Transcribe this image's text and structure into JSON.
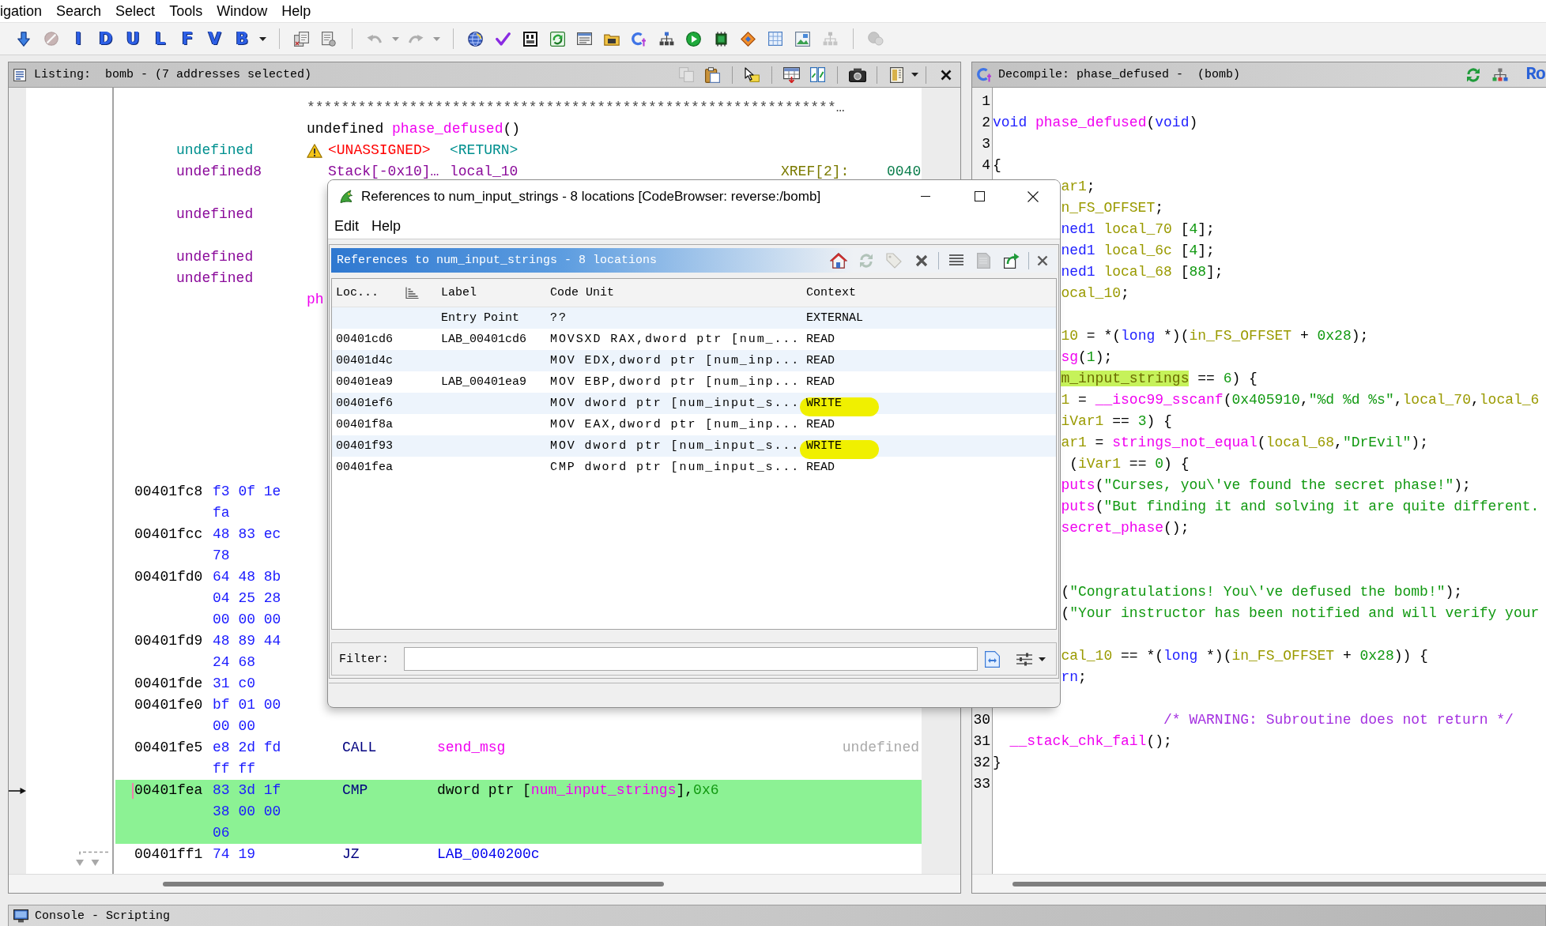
{
  "menu_bar": [
    "igation",
    "Search",
    "Select",
    "Tools",
    "Window",
    "Help"
  ],
  "toolbar": [
    [
      {
        "kind": "down-arrow",
        "disabled": false
      },
      {
        "kind": "stop",
        "disabled": true
      },
      {
        "kind": "letter",
        "label": "I",
        "disabled": false
      },
      {
        "kind": "letter",
        "label": "D",
        "disabled": false
      },
      {
        "kind": "letter",
        "label": "U",
        "disabled": false
      },
      {
        "kind": "letter",
        "label": "L",
        "disabled": false
      },
      {
        "kind": "letter",
        "label": "F",
        "disabled": false
      },
      {
        "kind": "letter",
        "label": "V",
        "disabled": false
      },
      {
        "kind": "letter",
        "label": "B",
        "disabled": false
      },
      {
        "kind": "caret",
        "disabled": false
      }
    ],
    [
      {
        "kind": "pages",
        "disabled": false
      },
      {
        "kind": "page",
        "disabled": false
      }
    ],
    [
      {
        "kind": "undo",
        "disabled": true
      },
      {
        "kind": "caret",
        "disabled": true
      },
      {
        "kind": "redo",
        "disabled": true
      },
      {
        "kind": "caret",
        "disabled": true
      }
    ],
    [
      {
        "kind": "globe",
        "disabled": false
      },
      {
        "kind": "check",
        "disabled": false
      },
      {
        "kind": "bytes",
        "disabled": false
      },
      {
        "kind": "script",
        "disabled": false
      },
      {
        "kind": "list",
        "disabled": false
      },
      {
        "kind": "folder",
        "disabled": false
      },
      {
        "kind": "code",
        "disabled": false
      },
      {
        "kind": "graph",
        "disabled": false
      },
      {
        "kind": "play",
        "disabled": false
      },
      {
        "kind": "chip",
        "disabled": false
      },
      {
        "kind": "diamond",
        "disabled": false
      },
      {
        "kind": "grid",
        "disabled": false
      },
      {
        "kind": "picture",
        "disabled": false
      },
      {
        "kind": "tree",
        "disabled": true
      }
    ],
    [
      {
        "kind": "bubble",
        "disabled": true
      }
    ]
  ],
  "listing": {
    "title": "Listing:  bomb - (7 addresses selected)",
    "toolbar": [
      [
        {
          "kind": "copy",
          "disabled": true
        },
        {
          "kind": "paste",
          "disabled": false
        }
      ],
      [
        {
          "kind": "cursor",
          "disabled": false
        }
      ],
      [
        {
          "kind": "header",
          "disabled": false
        },
        {
          "kind": "diff",
          "disabled": false
        }
      ],
      [
        {
          "kind": "camera",
          "disabled": false
        }
      ],
      [
        {
          "kind": "panel",
          "disabled": false
        },
        {
          "kind": "caret",
          "disabled": false
        }
      ],
      [
        {
          "kind": "close",
          "disabled": false
        }
      ]
    ],
    "header_lines": [
      {
        "kind": "stars",
        "text": "**************************************************************…"
      },
      {
        "kind": "signature",
        "tokens": [
          {
            "kind": "plain",
            "text": "undefined "
          },
          {
            "kind": "fn",
            "text": "phase_defused"
          },
          {
            "kind": "plain",
            "text": "()"
          }
        ]
      },
      {
        "kind": "return",
        "data_type": "undefined",
        "warning": true,
        "storage": "<UNASSIGNED>",
        "name": "<RETURN>"
      },
      {
        "kind": "variable",
        "data_type": "undefined8",
        "warning": false,
        "storage": "Stack[-0x10]…",
        "name": "local_10",
        "xref": "XREF[2]:",
        "xref_address": "0040"
      },
      {
        "kind": "blank"
      },
      {
        "kind": "variable",
        "data_type": "undefined",
        "warning": false
      },
      {
        "kind": "blank"
      },
      {
        "kind": "variable",
        "data_type": "undefined",
        "warning": false
      },
      {
        "kind": "variable",
        "data_type": "undefined",
        "warning": false
      },
      {
        "kind": "label",
        "text": "ph"
      }
    ],
    "rows": [
      {
        "address": "00401fc8",
        "bytes": "f3 0f 1e",
        "selected": false,
        "cursor": false,
        "branch": false
      },
      {
        "bytes": "fa",
        "selected": false,
        "cursor": false,
        "branch": false
      },
      {
        "address": "00401fcc",
        "bytes": "48 83 ec",
        "selected": false,
        "cursor": false,
        "branch": false
      },
      {
        "bytes": "78",
        "selected": false,
        "cursor": false,
        "branch": false
      },
      {
        "address": "00401fd0",
        "bytes": "64 48 8b",
        "selected": false,
        "cursor": false,
        "branch": false
      },
      {
        "bytes": "04 25 28",
        "selected": false,
        "cursor": false,
        "branch": false
      },
      {
        "bytes": "00 00 00",
        "selected": false,
        "cursor": false,
        "branch": false
      },
      {
        "address": "00401fd9",
        "bytes": "48 89 44",
        "selected": false,
        "cursor": false,
        "branch": false
      },
      {
        "bytes": "24 68",
        "selected": false,
        "cursor": false,
        "branch": false
      },
      {
        "address": "00401fde",
        "bytes": "31 c0",
        "selected": false,
        "cursor": false,
        "branch": false
      },
      {
        "address": "00401fe0",
        "bytes": "bf 01 00",
        "selected": false,
        "cursor": false,
        "branch": false
      },
      {
        "bytes": "00 00",
        "selected": false,
        "cursor": false,
        "branch": false
      },
      {
        "address": "00401fe5",
        "bytes": "e8 2d fd",
        "mnemonic": "CALL",
        "operand": [
          {
            "kind": "fn",
            "text": "send_msg"
          }
        ],
        "comment": "undefined",
        "selected": false,
        "cursor": false,
        "branch": false
      },
      {
        "bytes": "ff ff",
        "selected": false,
        "cursor": false,
        "branch": false
      },
      {
        "address": "00401fea",
        "bytes": "83 3d 1f",
        "mnemonic": "CMP",
        "operand": [
          {
            "kind": "plain",
            "text": "dword ptr ["
          },
          {
            "kind": "fn",
            "text": "num_input_strings"
          },
          {
            "kind": "plain",
            "text": "],"
          },
          {
            "kind": "num",
            "text": "0x6"
          }
        ],
        "selected": true,
        "cursor": true,
        "branch": false
      },
      {
        "bytes": "38 00 00",
        "selected": true,
        "cursor": false,
        "branch": false
      },
      {
        "bytes": "06",
        "selected": true,
        "cursor": false,
        "branch": false
      },
      {
        "address": "00401ff1",
        "bytes": "74 19",
        "mnemonic": "JZ",
        "operand": [
          {
            "kind": "label",
            "text": "LAB_0040200c"
          }
        ],
        "selected": false,
        "cursor": false,
        "branch": true
      }
    ]
  },
  "decompile": {
    "title": "Decompile: phase_defused -  (bomb)",
    "toolbar": [
      {
        "kind": "refresh",
        "disabled": false
      },
      {
        "kind": "tree-color",
        "disabled": false
      },
      {
        "kind": "text",
        "label": "Ro",
        "disabled": false
      }
    ],
    "lines": [
      {
        "kind": "blank",
        "number": "1"
      },
      {
        "kind": "code",
        "number": "2",
        "tokens": [
          {
            "kind": "kw",
            "text": "void "
          },
          {
            "kind": "fn",
            "text": "phase_defused"
          },
          {
            "kind": "plain",
            "text": "("
          },
          {
            "kind": "kw",
            "text": "void"
          },
          {
            "kind": "plain",
            "text": ")"
          }
        ]
      },
      {
        "kind": "blank",
        "number": "3"
      },
      {
        "kind": "code",
        "number": "4",
        "tokens": [
          {
            "kind": "plain",
            "text": "{"
          }
        ]
      },
      {
        "kind": "code",
        "tokens": [
          {
            "kind": "var",
            "text": "ar1"
          },
          {
            "kind": "plain",
            "text": ";"
          }
        ]
      },
      {
        "kind": "code",
        "tokens": [
          {
            "kind": "var",
            "text": "n_FS_OFFSET"
          },
          {
            "kind": "plain",
            "text": ";"
          }
        ]
      },
      {
        "kind": "code",
        "tokens": [
          {
            "kind": "kw",
            "text": "ned1 "
          },
          {
            "kind": "var",
            "text": "local_70"
          },
          {
            "kind": "plain",
            "text": " ["
          },
          {
            "kind": "num",
            "text": "4"
          },
          {
            "kind": "plain",
            "text": "];"
          }
        ]
      },
      {
        "kind": "code",
        "tokens": [
          {
            "kind": "kw",
            "text": "ned1 "
          },
          {
            "kind": "var",
            "text": "local_6c"
          },
          {
            "kind": "plain",
            "text": " ["
          },
          {
            "kind": "num",
            "text": "4"
          },
          {
            "kind": "plain",
            "text": "];"
          }
        ]
      },
      {
        "kind": "code",
        "tokens": [
          {
            "kind": "kw",
            "text": "ned1 "
          },
          {
            "kind": "var",
            "text": "local_68"
          },
          {
            "kind": "plain",
            "text": " ["
          },
          {
            "kind": "num",
            "text": "88"
          },
          {
            "kind": "plain",
            "text": "];"
          }
        ]
      },
      {
        "kind": "code",
        "tokens": [
          {
            "kind": "var",
            "text": "ocal_10"
          },
          {
            "kind": "plain",
            "text": ";"
          }
        ]
      },
      {
        "kind": "blank"
      },
      {
        "kind": "code",
        "tokens": [
          {
            "kind": "var",
            "text": "10"
          },
          {
            "kind": "plain",
            "text": " = *("
          },
          {
            "kind": "kw",
            "text": "long"
          },
          {
            "kind": "plain",
            "text": " *)("
          },
          {
            "kind": "var",
            "text": "in_FS_OFFSET"
          },
          {
            "kind": "plain",
            "text": " + "
          },
          {
            "kind": "num",
            "text": "0x28"
          },
          {
            "kind": "plain",
            "text": ");"
          }
        ]
      },
      {
        "kind": "code",
        "tokens": [
          {
            "kind": "fn",
            "text": "sg"
          },
          {
            "kind": "plain",
            "text": "("
          },
          {
            "kind": "num",
            "text": "1"
          },
          {
            "kind": "plain",
            "text": ");"
          }
        ]
      },
      {
        "kind": "code",
        "tokens": [
          {
            "kind": "hit",
            "text": "m_input_strings"
          },
          {
            "kind": "plain",
            "text": " == "
          },
          {
            "kind": "num",
            "text": "6"
          },
          {
            "kind": "plain",
            "text": ") {"
          }
        ]
      },
      {
        "kind": "code",
        "tokens": [
          {
            "kind": "var",
            "text": "1"
          },
          {
            "kind": "plain",
            "text": " = "
          },
          {
            "kind": "fn",
            "text": "__isoc99_sscanf"
          },
          {
            "kind": "plain",
            "text": "("
          },
          {
            "kind": "num",
            "text": "0x405910"
          },
          {
            "kind": "plain",
            "text": ","
          },
          {
            "kind": "str",
            "text": "\"%d %d %s\""
          },
          {
            "kind": "plain",
            "text": ","
          },
          {
            "kind": "var",
            "text": "local_70"
          },
          {
            "kind": "plain",
            "text": ","
          },
          {
            "kind": "var",
            "text": "local_6"
          }
        ]
      },
      {
        "kind": "code",
        "tokens": [
          {
            "kind": "var",
            "text": "iVar1"
          },
          {
            "kind": "plain",
            "text": " == "
          },
          {
            "kind": "num",
            "text": "3"
          },
          {
            "kind": "plain",
            "text": ") {"
          }
        ]
      },
      {
        "kind": "code",
        "tokens": [
          {
            "kind": "var",
            "text": "ar1"
          },
          {
            "kind": "plain",
            "text": " = "
          },
          {
            "kind": "fn",
            "text": "strings_not_equal"
          },
          {
            "kind": "plain",
            "text": "("
          },
          {
            "kind": "var",
            "text": "local_68"
          },
          {
            "kind": "plain",
            "text": ","
          },
          {
            "kind": "str",
            "text": "\"DrEvil\""
          },
          {
            "kind": "plain",
            "text": ");"
          }
        ]
      },
      {
        "kind": "code",
        "tokens": [
          {
            "kind": "plain",
            "text": " ("
          },
          {
            "kind": "var",
            "text": "iVar1"
          },
          {
            "kind": "plain",
            "text": " == "
          },
          {
            "kind": "num",
            "text": "0"
          },
          {
            "kind": "plain",
            "text": ") {"
          }
        ]
      },
      {
        "kind": "code",
        "tokens": [
          {
            "kind": "fn",
            "text": "puts"
          },
          {
            "kind": "plain",
            "text": "("
          },
          {
            "kind": "str",
            "text": "\"Curses, you\\'ve found the secret phase!\""
          },
          {
            "kind": "plain",
            "text": ");"
          }
        ]
      },
      {
        "kind": "code",
        "tokens": [
          {
            "kind": "fn",
            "text": "puts"
          },
          {
            "kind": "plain",
            "text": "("
          },
          {
            "kind": "str",
            "text": "\"But finding it and solving it are quite different."
          }
        ]
      },
      {
        "kind": "code",
        "tokens": [
          {
            "kind": "fn",
            "text": "secret_phase"
          },
          {
            "kind": "plain",
            "text": "();"
          }
        ]
      },
      {
        "kind": "blank"
      },
      {
        "kind": "blank"
      },
      {
        "kind": "code",
        "tokens": [
          {
            "kind": "plain",
            "text": "("
          },
          {
            "kind": "str",
            "text": "\"Congratulations! You\\'ve defused the bomb!\""
          },
          {
            "kind": "plain",
            "text": ");"
          }
        ]
      },
      {
        "kind": "code",
        "tokens": [
          {
            "kind": "plain",
            "text": "("
          },
          {
            "kind": "str",
            "text": "\"Your instructor has been notified and will verify your"
          }
        ]
      },
      {
        "kind": "blank"
      },
      {
        "kind": "code",
        "tokens": [
          {
            "kind": "var",
            "text": "cal_10"
          },
          {
            "kind": "plain",
            "text": " == *("
          },
          {
            "kind": "kw",
            "text": "long"
          },
          {
            "kind": "plain",
            "text": " *)("
          },
          {
            "kind": "var",
            "text": "in_FS_OFFSET"
          },
          {
            "kind": "plain",
            "text": " + "
          },
          {
            "kind": "num",
            "text": "0x28"
          },
          {
            "kind": "plain",
            "text": ")) {"
          }
        ]
      },
      {
        "kind": "code",
        "tokens": [
          {
            "kind": "kw",
            "text": "rn"
          },
          {
            "kind": "plain",
            "text": ";"
          }
        ]
      },
      {
        "kind": "blank"
      },
      {
        "kind": "code",
        "number": "30",
        "tokens": [
          {
            "kind": "cmt",
            "text": "                    /* WARNING: Subroutine does not return */"
          }
        ]
      },
      {
        "kind": "code",
        "number": "31",
        "tokens": [
          {
            "kind": "fn",
            "text": "  __stack_chk_fail"
          },
          {
            "kind": "plain",
            "text": "();"
          }
        ]
      },
      {
        "kind": "code",
        "number": "32",
        "tokens": [
          {
            "kind": "plain",
            "text": "}"
          }
        ]
      },
      {
        "kind": "blank",
        "number": "33"
      }
    ]
  },
  "dialog": {
    "title": "References to num_input_strings - 8 locations [CodeBrowser: reverse:/bomb]",
    "menu": [
      "Edit",
      "Help"
    ],
    "panel_title": "References to num_input_strings - 8 locations",
    "panel_toolbar": [
      [
        {
          "kind": "home",
          "disabled": false
        },
        {
          "kind": "refresh",
          "disabled": true
        },
        {
          "kind": "tag",
          "disabled": true
        },
        {
          "kind": "delete",
          "disabled": false
        }
      ],
      [
        {
          "kind": "lines",
          "disabled": false
        },
        {
          "kind": "table",
          "disabled": true
        },
        {
          "kind": "export",
          "disabled": false
        }
      ],
      [
        {
          "kind": "dismiss",
          "disabled": false
        }
      ]
    ],
    "columns": [
      "Loc...",
      "Label",
      "Code Unit",
      "Context"
    ],
    "rows": [
      {
        "label": "Entry Point",
        "code_unit": "??",
        "context": "EXTERNAL",
        "selected": false,
        "highlighted": false
      },
      {
        "location": "00401cd6",
        "label": "LAB_00401cd6",
        "code_unit": "MOVSXD RAX,dword ptr [num_...",
        "context": "READ",
        "selected": false,
        "highlighted": false
      },
      {
        "location": "00401d4c",
        "code_unit": "MOV EDX,dword ptr [num_inp...",
        "context": "READ",
        "selected": false,
        "highlighted": false
      },
      {
        "location": "00401ea9",
        "label": "LAB_00401ea9",
        "code_unit": "MOV EBP,dword ptr [num_inp...",
        "context": "READ",
        "selected": false,
        "highlighted": false
      },
      {
        "location": "00401ef6",
        "code_unit": "MOV dword ptr [num_input_s...",
        "context": "WRITE",
        "selected": false,
        "highlighted": true
      },
      {
        "location": "00401f8a",
        "code_unit": "MOV EAX,dword ptr [num_inp...",
        "context": "READ",
        "selected": false,
        "highlighted": false
      },
      {
        "location": "00401f93",
        "code_unit": "MOV dword ptr [num_input_s...",
        "context": "WRITE",
        "selected": false,
        "highlighted": true
      },
      {
        "location": "00401fea",
        "code_unit": "CMP dword ptr [num_input_s...",
        "context": "READ",
        "selected": false,
        "highlighted": false
      }
    ],
    "filter": {
      "label": "Filter:"
    }
  },
  "console": {
    "title": "Console - Scripting"
  }
}
